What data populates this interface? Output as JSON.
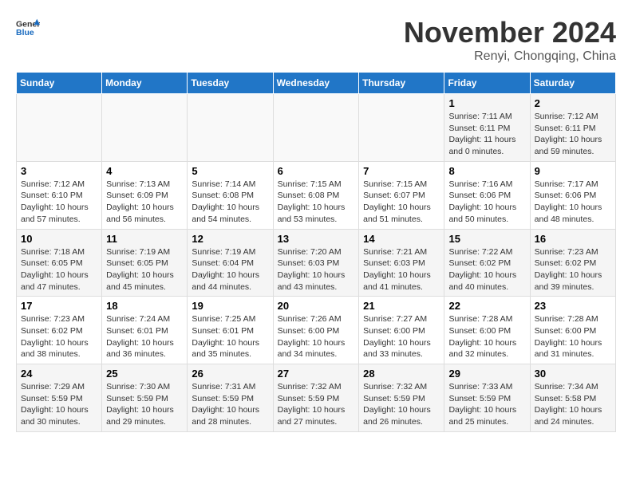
{
  "logo": {
    "text_general": "General",
    "text_blue": "Blue"
  },
  "title": {
    "month_year": "November 2024",
    "location": "Renyi, Chongqing, China"
  },
  "days_of_week": [
    "Sunday",
    "Monday",
    "Tuesday",
    "Wednesday",
    "Thursday",
    "Friday",
    "Saturday"
  ],
  "weeks": [
    [
      {
        "day": "",
        "info": ""
      },
      {
        "day": "",
        "info": ""
      },
      {
        "day": "",
        "info": ""
      },
      {
        "day": "",
        "info": ""
      },
      {
        "day": "",
        "info": ""
      },
      {
        "day": "1",
        "info": "Sunrise: 7:11 AM\nSunset: 6:11 PM\nDaylight: 11 hours\nand 0 minutes."
      },
      {
        "day": "2",
        "info": "Sunrise: 7:12 AM\nSunset: 6:11 PM\nDaylight: 10 hours\nand 59 minutes."
      }
    ],
    [
      {
        "day": "3",
        "info": "Sunrise: 7:12 AM\nSunset: 6:10 PM\nDaylight: 10 hours\nand 57 minutes."
      },
      {
        "day": "4",
        "info": "Sunrise: 7:13 AM\nSunset: 6:09 PM\nDaylight: 10 hours\nand 56 minutes."
      },
      {
        "day": "5",
        "info": "Sunrise: 7:14 AM\nSunset: 6:08 PM\nDaylight: 10 hours\nand 54 minutes."
      },
      {
        "day": "6",
        "info": "Sunrise: 7:15 AM\nSunset: 6:08 PM\nDaylight: 10 hours\nand 53 minutes."
      },
      {
        "day": "7",
        "info": "Sunrise: 7:15 AM\nSunset: 6:07 PM\nDaylight: 10 hours\nand 51 minutes."
      },
      {
        "day": "8",
        "info": "Sunrise: 7:16 AM\nSunset: 6:06 PM\nDaylight: 10 hours\nand 50 minutes."
      },
      {
        "day": "9",
        "info": "Sunrise: 7:17 AM\nSunset: 6:06 PM\nDaylight: 10 hours\nand 48 minutes."
      }
    ],
    [
      {
        "day": "10",
        "info": "Sunrise: 7:18 AM\nSunset: 6:05 PM\nDaylight: 10 hours\nand 47 minutes."
      },
      {
        "day": "11",
        "info": "Sunrise: 7:19 AM\nSunset: 6:05 PM\nDaylight: 10 hours\nand 45 minutes."
      },
      {
        "day": "12",
        "info": "Sunrise: 7:19 AM\nSunset: 6:04 PM\nDaylight: 10 hours\nand 44 minutes."
      },
      {
        "day": "13",
        "info": "Sunrise: 7:20 AM\nSunset: 6:03 PM\nDaylight: 10 hours\nand 43 minutes."
      },
      {
        "day": "14",
        "info": "Sunrise: 7:21 AM\nSunset: 6:03 PM\nDaylight: 10 hours\nand 41 minutes."
      },
      {
        "day": "15",
        "info": "Sunrise: 7:22 AM\nSunset: 6:02 PM\nDaylight: 10 hours\nand 40 minutes."
      },
      {
        "day": "16",
        "info": "Sunrise: 7:23 AM\nSunset: 6:02 PM\nDaylight: 10 hours\nand 39 minutes."
      }
    ],
    [
      {
        "day": "17",
        "info": "Sunrise: 7:23 AM\nSunset: 6:02 PM\nDaylight: 10 hours\nand 38 minutes."
      },
      {
        "day": "18",
        "info": "Sunrise: 7:24 AM\nSunset: 6:01 PM\nDaylight: 10 hours\nand 36 minutes."
      },
      {
        "day": "19",
        "info": "Sunrise: 7:25 AM\nSunset: 6:01 PM\nDaylight: 10 hours\nand 35 minutes."
      },
      {
        "day": "20",
        "info": "Sunrise: 7:26 AM\nSunset: 6:00 PM\nDaylight: 10 hours\nand 34 minutes."
      },
      {
        "day": "21",
        "info": "Sunrise: 7:27 AM\nSunset: 6:00 PM\nDaylight: 10 hours\nand 33 minutes."
      },
      {
        "day": "22",
        "info": "Sunrise: 7:28 AM\nSunset: 6:00 PM\nDaylight: 10 hours\nand 32 minutes."
      },
      {
        "day": "23",
        "info": "Sunrise: 7:28 AM\nSunset: 6:00 PM\nDaylight: 10 hours\nand 31 minutes."
      }
    ],
    [
      {
        "day": "24",
        "info": "Sunrise: 7:29 AM\nSunset: 5:59 PM\nDaylight: 10 hours\nand 30 minutes."
      },
      {
        "day": "25",
        "info": "Sunrise: 7:30 AM\nSunset: 5:59 PM\nDaylight: 10 hours\nand 29 minutes."
      },
      {
        "day": "26",
        "info": "Sunrise: 7:31 AM\nSunset: 5:59 PM\nDaylight: 10 hours\nand 28 minutes."
      },
      {
        "day": "27",
        "info": "Sunrise: 7:32 AM\nSunset: 5:59 PM\nDaylight: 10 hours\nand 27 minutes."
      },
      {
        "day": "28",
        "info": "Sunrise: 7:32 AM\nSunset: 5:59 PM\nDaylight: 10 hours\nand 26 minutes."
      },
      {
        "day": "29",
        "info": "Sunrise: 7:33 AM\nSunset: 5:59 PM\nDaylight: 10 hours\nand 25 minutes."
      },
      {
        "day": "30",
        "info": "Sunrise: 7:34 AM\nSunset: 5:58 PM\nDaylight: 10 hours\nand 24 minutes."
      }
    ]
  ]
}
